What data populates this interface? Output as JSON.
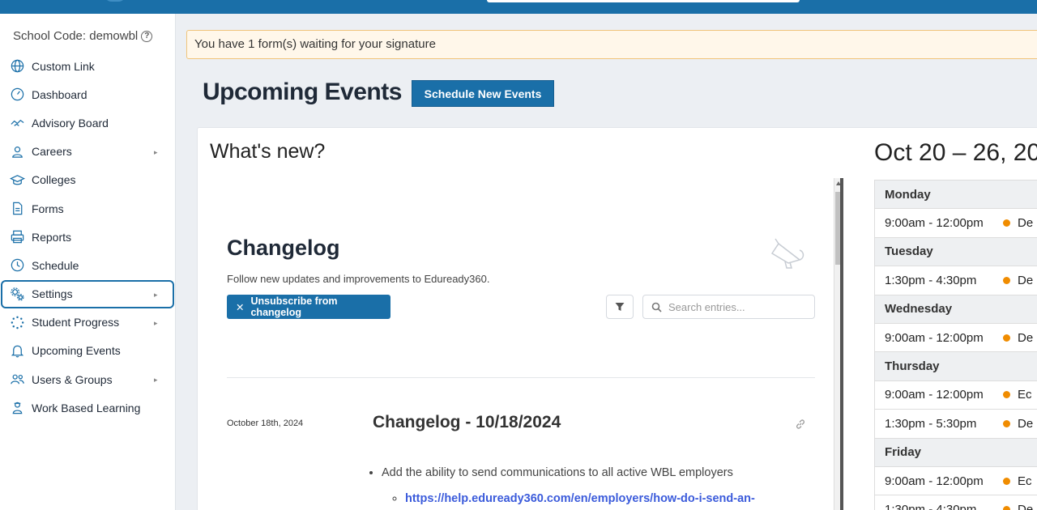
{
  "sidebar": {
    "school_code": "School Code: demowbl",
    "items": [
      {
        "label": "Custom Link"
      },
      {
        "label": "Dashboard"
      },
      {
        "label": "Advisory Board"
      },
      {
        "label": "Careers"
      },
      {
        "label": "Colleges"
      },
      {
        "label": "Forms"
      },
      {
        "label": "Reports"
      },
      {
        "label": "Schedule"
      },
      {
        "label": "Settings"
      },
      {
        "label": "Student Progress"
      },
      {
        "label": "Upcoming Events"
      },
      {
        "label": "Users & Groups"
      },
      {
        "label": "Work Based Learning"
      }
    ]
  },
  "alert": {
    "text": "You have 1 form(s) waiting for your signature"
  },
  "main": {
    "title": "Upcoming Events",
    "schedule_button": "Schedule New Events",
    "whats_new": "What's new?"
  },
  "changelog": {
    "title": "Changelog",
    "subtitle": "Follow new updates and improvements to Eduready360.",
    "unsubscribe": "Unsubscribe from changelog",
    "search_placeholder": "Search entries...",
    "entry": {
      "date": "October 18th, 2024",
      "title": "Changelog - 10/18/2024",
      "bullet": "Add the ability to send communications to all active WBL employers",
      "link": "https://help.eduready360.com/en/employers/how-do-i-send-an-"
    }
  },
  "calendar": {
    "title": "Oct 20 – 26, 20",
    "rows": [
      {
        "type": "day",
        "text": "Monday"
      },
      {
        "type": "ev",
        "time": "9:00am - 12:00pm",
        "label": "De"
      },
      {
        "type": "day",
        "text": "Tuesday"
      },
      {
        "type": "ev",
        "time": "1:30pm - 4:30pm",
        "label": "De"
      },
      {
        "type": "day",
        "text": "Wednesday"
      },
      {
        "type": "ev",
        "time": "9:00am - 12:00pm",
        "label": "De"
      },
      {
        "type": "day",
        "text": "Thursday"
      },
      {
        "type": "ev",
        "time": "9:00am - 12:00pm",
        "label": "Ec"
      },
      {
        "type": "ev",
        "time": "1:30pm - 5:30pm",
        "label": "De"
      },
      {
        "type": "day",
        "text": "Friday"
      },
      {
        "type": "ev",
        "time": "9:00am - 12:00pm",
        "label": "Ec"
      },
      {
        "type": "ev",
        "time": "1:30pm - 4:30pm",
        "label": "De"
      }
    ]
  },
  "colors": {
    "brand": "#1a6fa8",
    "alert_bg": "#fff7ea",
    "event_dot": "#f08c00"
  }
}
